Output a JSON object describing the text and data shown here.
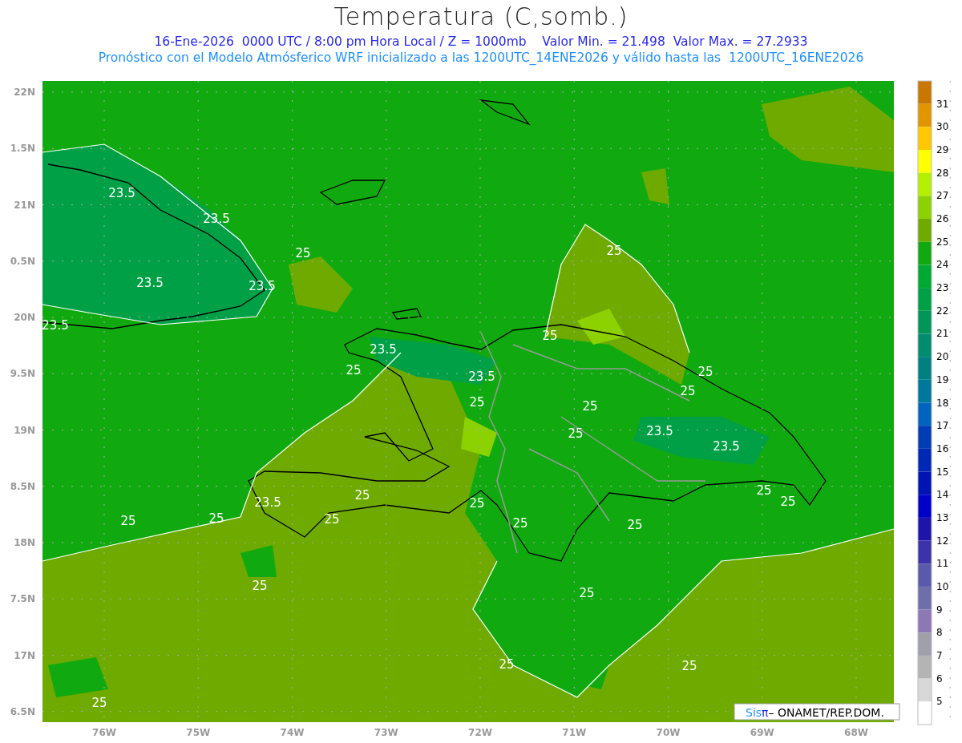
{
  "title": "Temperatura (C,somb.)",
  "subtitle": "16-Ene-2026  0000 UTC / 8:00 pm Hora Local / Z = 1000mb    Valor Min. = 21.498  Valor Max. = 27.2933",
  "description": "Pronóstico con el Modelo Atmósferico WRF inicializado a las 1200UTC_14ENE2026 y válido hasta las  1200UTC_16ENE2026",
  "map": {
    "lat_labels": [
      "22N",
      "1.5N",
      "21N",
      "0.5N",
      "20N",
      "9.5N",
      "19N",
      "8.5N",
      "18N",
      "7.5N",
      "17N",
      "6.5N"
    ],
    "lon_labels": [
      "76W",
      "75W",
      "74W",
      "73W",
      "72W",
      "71W",
      "70W",
      "69W",
      "68W"
    ],
    "contour_labels": [
      "23.5",
      "23.5",
      "25",
      "25",
      "23.5",
      "23.5",
      "23.5",
      "25",
      "23.5",
      "25",
      "25",
      "23.5",
      "25",
      "25",
      "25",
      "23.5",
      "25",
      "23.5",
      "23.5",
      "25",
      "25",
      "25",
      "25",
      "25",
      "25",
      "25",
      "25",
      "25",
      "25",
      "25",
      "25",
      "25",
      "25"
    ],
    "credit": {
      "brand": "Sis",
      "symbol": "π",
      "text": "– ONAMET/REP.DOM."
    }
  },
  "colorbar": [
    {
      "label": "31",
      "color": "#c87800"
    },
    {
      "label": "30",
      "color": "#e19600"
    },
    {
      "label": "29",
      "color": "#ffc800"
    },
    {
      "label": "28",
      "color": "#ffff00"
    },
    {
      "label": "27",
      "color": "#b4f000"
    },
    {
      "label": "26",
      "color": "#8cd200"
    },
    {
      "label": "25",
      "color": "#6eaa00"
    },
    {
      "label": "24",
      "color": "#10aa10"
    },
    {
      "label": "23",
      "color": "#00aa32"
    },
    {
      "label": "22",
      "color": "#00a046"
    },
    {
      "label": "21",
      "color": "#00965a"
    },
    {
      "label": "20",
      "color": "#008c6e"
    },
    {
      "label": "19",
      "color": "#008080"
    },
    {
      "label": "18",
      "color": "#00789a"
    },
    {
      "label": "17",
      "color": "#0064be"
    },
    {
      "label": "16",
      "color": "#003cb4"
    },
    {
      "label": "15",
      "color": "#0028b4"
    },
    {
      "label": "14",
      "color": "#0014b4"
    },
    {
      "label": "13",
      "color": "#0000c8"
    },
    {
      "label": "12",
      "color": "#1e14aa"
    },
    {
      "label": "11",
      "color": "#3c32aa"
    },
    {
      "label": "10",
      "color": "#5a5aaa"
    },
    {
      "label": "9",
      "color": "#6e6eaa"
    },
    {
      "label": "8",
      "color": "#8c78b4"
    },
    {
      "label": "7",
      "color": "#a0a0aa"
    },
    {
      "label": "6",
      "color": "#b4b4b4"
    },
    {
      "label": "5",
      "color": "#d8d8d8"
    },
    {
      "color": "#ffffff"
    }
  ]
}
